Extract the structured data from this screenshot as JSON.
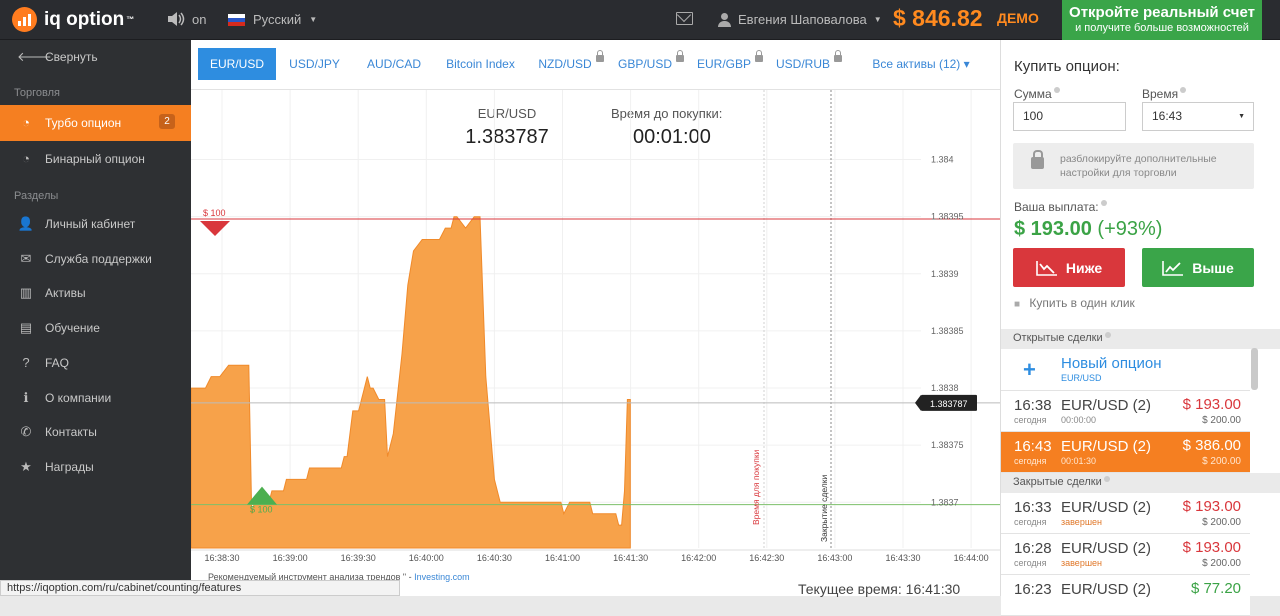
{
  "header": {
    "logo_text": "iq option",
    "trademark": "™",
    "sound_label": "on",
    "language": "Русский",
    "user_name": "Евгения Шаповалова",
    "balance": "$ 846.82",
    "account_type": "ДЕМО",
    "real_account_title": "Откройте реальный счет",
    "real_account_sub": "и получите больше возможностей",
    "colors": {
      "brand": "#ff7c1f",
      "green": "#3aa549",
      "red": "#d9373c"
    }
  },
  "sidebar": {
    "collapse": "Свернуть",
    "section_trading": "Торговля",
    "turbo": "Турбо опцион",
    "turbo_badge": "2",
    "binary": "Бинарный опцион",
    "section_sections": "Разделы",
    "items": [
      "Личный кабинет",
      "Служба поддержки",
      "Активы",
      "Обучение",
      "FAQ",
      "О компании",
      "Контакты",
      "Награды"
    ],
    "item_icons": [
      "user-icon",
      "mail-icon",
      "bar-chart-icon",
      "book-icon",
      "faq-icon",
      "info-icon",
      "chat-icon",
      "star-icon"
    ]
  },
  "tabs": [
    {
      "label": "EUR/USD",
      "locked": false,
      "selected": true
    },
    {
      "label": "USD/JPY",
      "locked": false
    },
    {
      "label": "AUD/CAD",
      "locked": false
    },
    {
      "label": "Bitcoin Index",
      "locked": false
    },
    {
      "label": "NZD/USD",
      "locked": true
    },
    {
      "label": "GBP/USD",
      "locked": true
    },
    {
      "label": "EUR/GBP",
      "locked": true
    },
    {
      "label": "USD/RUB",
      "locked": true
    },
    {
      "label": "Все активы (12)",
      "locked": false
    }
  ],
  "chart": {
    "pair_label": "EUR/USD",
    "pair_value": "1.383787",
    "time_label": "Время до покупки:",
    "time_value": "00:01:00",
    "recommended": "Рекомендуемый инструмент анализа трендов \" -",
    "investing": "Investing.com",
    "current_time_label": "Текущее время:",
    "current_time": "16:41:30",
    "buy_time_label": "Время для покупки",
    "close_label": "Закрытие сделки",
    "marker_red": "$ 100",
    "marker_green": "$ 100"
  },
  "chart_data": {
    "type": "area",
    "x_ticks": [
      "16:38:30",
      "16:39:00",
      "16:39:30",
      "16:40:00",
      "16:40:30",
      "16:41:00",
      "16:41:30",
      "16:42:00",
      "16:42:30",
      "16:43:00",
      "16:43:30",
      "16:44:00"
    ],
    "y_ticks": [
      "1.384",
      "1.38395",
      "1.3839",
      "1.38385",
      "1.3838",
      "1.38375",
      "1.3837"
    ],
    "ylim": [
      1.38366,
      1.38406
    ],
    "current_price_label": "1.383787",
    "levels": {
      "red": 1.383948,
      "green": 1.383698,
      "current": 1.383787
    },
    "x": [
      0,
      10,
      14,
      20,
      26,
      30,
      34,
      40,
      42,
      44,
      50,
      54,
      56,
      58,
      60,
      62,
      64,
      66,
      70,
      74,
      76,
      78,
      80,
      82,
      84,
      90,
      95,
      100,
      104,
      106,
      108,
      112,
      116,
      118,
      120,
      122,
      124,
      126,
      130,
      132,
      134,
      136,
      140,
      146,
      150,
      154,
      160,
      166,
      172,
      176,
      180,
      182,
      184,
      190,
      196,
      200,
      204,
      210,
      214,
      220,
      222,
      224,
      226,
      228,
      230,
      232,
      234,
      236,
      238,
      240,
      242,
      244,
      246,
      248,
      250,
      254,
      256,
      258,
      262,
      264,
      266,
      270,
      274,
      276,
      278,
      280,
      282,
      284,
      286,
      288,
      290,
      292,
      294,
      296,
      298,
      300,
      302,
      304
    ],
    "values": [
      1.3838,
      1.3838,
      1.38381,
      1.38381,
      1.38382,
      1.38382,
      1.38382,
      1.38382,
      1.38369,
      1.3837,
      1.3837,
      1.3837,
      1.38371,
      1.38371,
      1.38371,
      1.38371,
      1.38371,
      1.38372,
      1.38372,
      1.38372,
      1.38372,
      1.38372,
      1.38372,
      1.38373,
      1.38373,
      1.38373,
      1.38373,
      1.38373,
      1.38373,
      1.38374,
      1.38374,
      1.38378,
      1.38378,
      1.38379,
      1.3838,
      1.38381,
      1.3838,
      1.3838,
      1.38379,
      1.38379,
      1.38379,
      1.38374,
      1.38376,
      1.38383,
      1.38389,
      1.38392,
      1.38393,
      1.38393,
      1.38393,
      1.38394,
      1.38394,
      1.38395,
      1.38395,
      1.38394,
      1.38395,
      1.38395,
      1.38381,
      1.38372,
      1.3837,
      1.3837,
      1.3837,
      1.3837,
      1.3837,
      1.3837,
      1.3837,
      1.3837,
      1.3837,
      1.3837,
      1.3837,
      1.3837,
      1.3837,
      1.3837,
      1.3837,
      1.3837,
      1.3837,
      1.3837,
      1.3837,
      1.38369,
      1.3837,
      1.3837,
      1.3837,
      1.3837,
      1.3837,
      1.3837,
      1.38369,
      1.38369,
      1.38369,
      1.38369,
      1.38369,
      1.38369,
      1.38369,
      1.38369,
      1.38369,
      1.38368,
      1.38368,
      1.38371,
      1.38379,
      1.38379
    ]
  },
  "panel": {
    "title": "Купить опцион:",
    "amount_label": "Сумма",
    "amount_value": "100",
    "time_label": "Время",
    "time_value": "16:43",
    "unlock_l1": "разблокируйте дополнительные",
    "unlock_l2": "настройки для торговли",
    "payout_label": "Ваша выплата:",
    "payout_value": "$ 193.00",
    "payout_pct": "(+93%)",
    "down": "Ниже",
    "up": "Выше",
    "oneclick": "Купить в один клик",
    "open_title": "Открытые сделки",
    "new_option": "Новый опцион",
    "new_option_pair": "EUR/USD",
    "closed_title": "Закрытые сделки"
  },
  "open_deals": [
    {
      "time": "16:38",
      "day": "сегодня",
      "pair": "EUR/USD (2)",
      "sub": "00:00:00",
      "amount": "$ 193.00",
      "invest": "$ 200.00"
    },
    {
      "time": "16:43",
      "day": "сегодня",
      "pair": "EUR/USD (2)",
      "sub": "00:01:30",
      "amount": "$ 386.00",
      "invest": "$ 200.00"
    }
  ],
  "closed_deals": [
    {
      "time": "16:33",
      "day": "сегодня",
      "pair": "EUR/USD (2)",
      "sub": "завершен",
      "amount": "$ 193.00",
      "invest": "$ 200.00"
    },
    {
      "time": "16:28",
      "day": "сегодня",
      "pair": "EUR/USD (2)",
      "sub": "завершен",
      "amount": "$ 193.00",
      "invest": "$ 200.00"
    },
    {
      "time": "16:23",
      "pair": "EUR/USD (2)",
      "amount": "$ 77.20"
    }
  ],
  "statusbar": "https://iqoption.com/ru/cabinet/counting/features"
}
